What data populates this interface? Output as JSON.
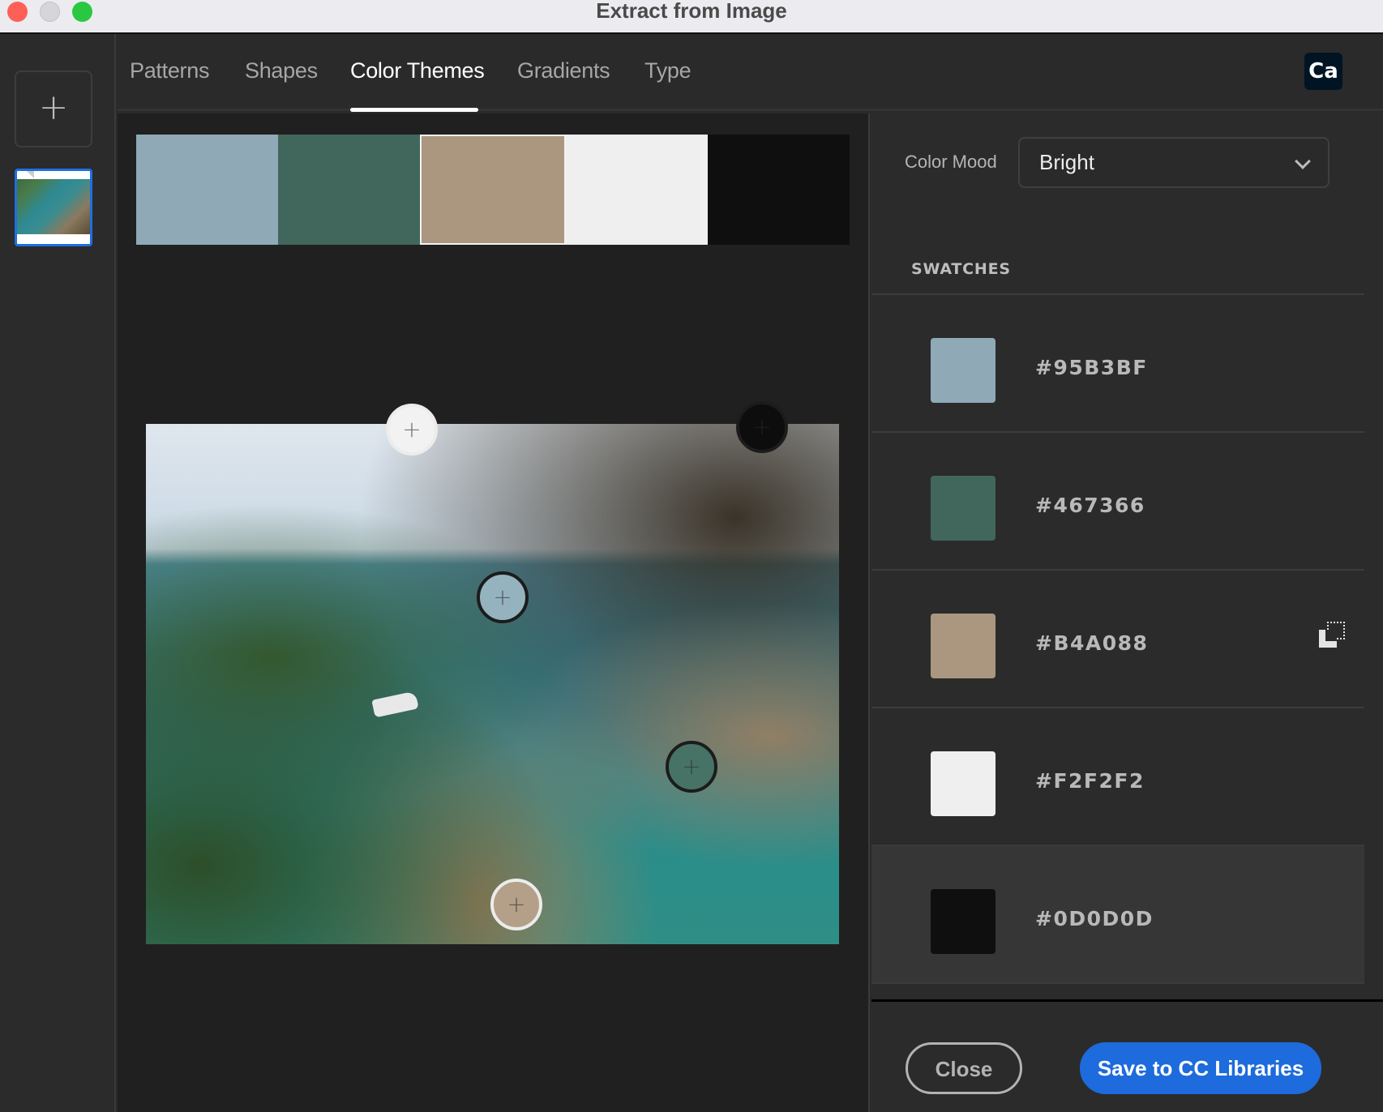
{
  "window": {
    "title": "Extract from Image",
    "controls": [
      "close",
      "minimize",
      "maximize"
    ]
  },
  "sidebar": {
    "add_label": "+",
    "thumbnail_selected": true
  },
  "tabs": [
    {
      "label": "Patterns",
      "active": false
    },
    {
      "label": "Shapes",
      "active": false
    },
    {
      "label": "Color Themes",
      "active": true
    },
    {
      "label": "Gradients",
      "active": false
    },
    {
      "label": "Type",
      "active": false
    }
  ],
  "app_badge": "Ca",
  "theme": {
    "colors": [
      "#95B3BF",
      "#467366",
      "#B4A088",
      "#F2F2F2",
      "#0D0D0D"
    ],
    "selected_index": 2
  },
  "markers": [
    {
      "color": "#F2F2F2",
      "symbol": "+"
    },
    {
      "color": "#0D0D0D",
      "symbol": "+"
    },
    {
      "color": "#95B3BF",
      "symbol": "+"
    },
    {
      "color": "#467366",
      "symbol": "+"
    },
    {
      "color": "#B4A088",
      "symbol": "+"
    }
  ],
  "right_panel": {
    "color_mood_label": "Color Mood",
    "color_mood_value": "Bright",
    "swatches_title": "SWATCHES",
    "swatches": [
      {
        "hex": "#95B3BF",
        "color": "#8faab6"
      },
      {
        "hex": "#467366",
        "color": "#41675c"
      },
      {
        "hex": "#B4A088",
        "color": "#ab977f"
      },
      {
        "hex": "#F2F2F2",
        "color": "#efefef"
      },
      {
        "hex": "#0D0D0D",
        "color": "#0f0f0f"
      }
    ],
    "hovered_row_index": 4,
    "copy_icon_row_index": 2
  },
  "buttons": {
    "close": "Close",
    "save": "Save to CC Libraries"
  },
  "accent_color": "#1D6BDC"
}
